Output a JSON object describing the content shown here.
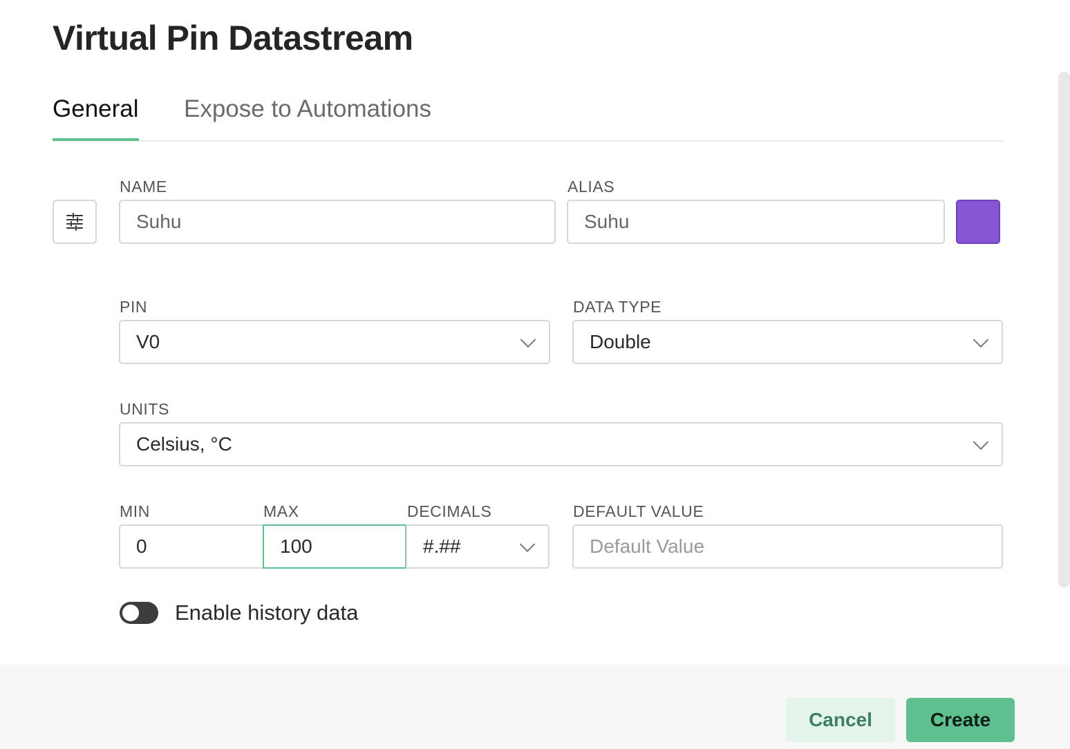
{
  "dialog": {
    "title": "Virtual Pin Datastream"
  },
  "tabs": [
    {
      "label": "General",
      "active": true
    },
    {
      "label": "Expose to Automations",
      "active": false
    }
  ],
  "form": {
    "name": {
      "label": "NAME",
      "value": "Suhu"
    },
    "alias": {
      "label": "ALIAS",
      "value": "Suhu"
    },
    "color": "#8656d4",
    "pin": {
      "label": "PIN",
      "value": "V0"
    },
    "data_type": {
      "label": "DATA TYPE",
      "value": "Double"
    },
    "units": {
      "label": "UNITS",
      "value": "Celsius, °C"
    },
    "min": {
      "label": "MIN",
      "value": "0"
    },
    "max": {
      "label": "MAX",
      "value": "100"
    },
    "decimals": {
      "label": "DECIMALS",
      "value": "#.##"
    },
    "default_value": {
      "label": "DEFAULT VALUE",
      "placeholder": "Default Value"
    },
    "history": {
      "label": "Enable history data",
      "enabled": false
    }
  },
  "footer": {
    "cancel_label": "Cancel",
    "create_label": "Create"
  },
  "icons": {
    "datastream_settings": "sliders-icon",
    "dropdown": "chevron-down-icon"
  }
}
